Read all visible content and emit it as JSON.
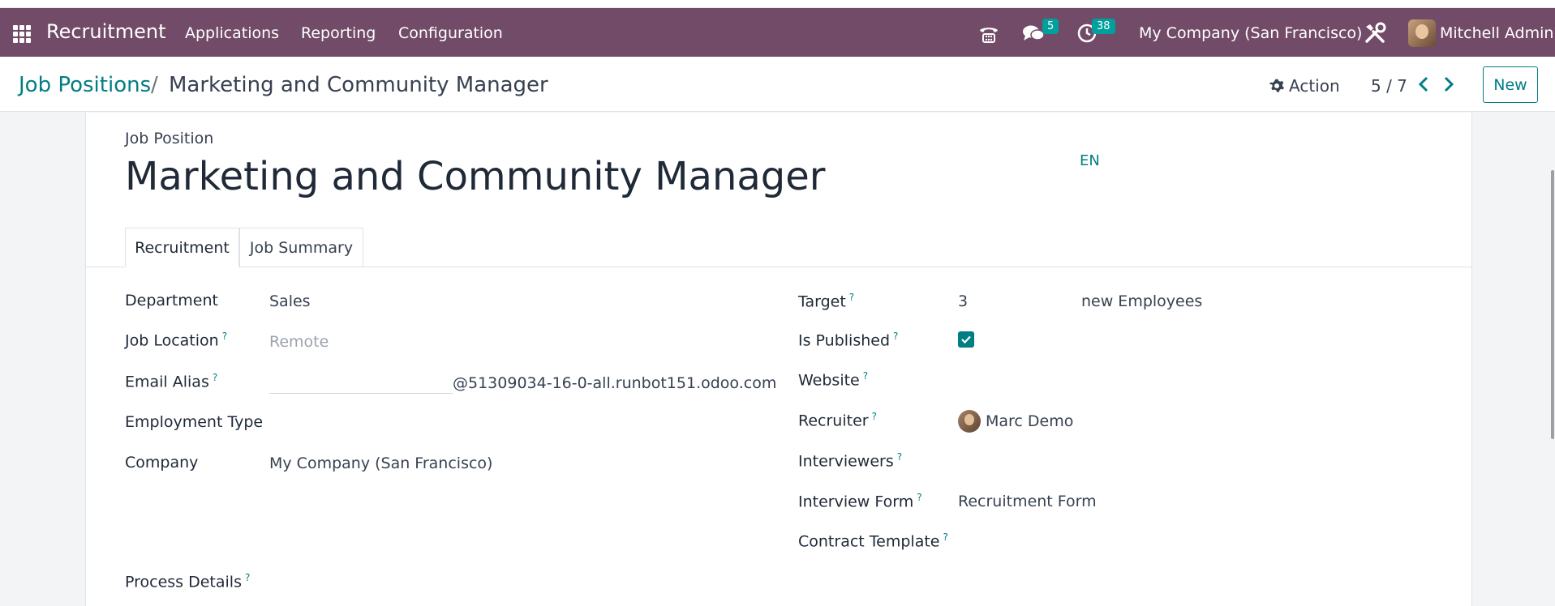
{
  "navbar": {
    "app_name": "Recruitment",
    "menus": [
      "Applications",
      "Reporting",
      "Configuration"
    ],
    "messages_count": "5",
    "activities_count": "38",
    "company": "My Company (San Francisco)",
    "user": "Mitchell Admin",
    "bg_color": "#714b67",
    "badge_color": "#00a09d"
  },
  "control_panel": {
    "breadcrumb_parent": "Job Positions",
    "breadcrumb_sep": "/",
    "breadcrumb_current": "Marketing and Community Manager",
    "action_label": "Action",
    "pager": "5 / 7",
    "new_label": "New"
  },
  "form": {
    "name_label": "Job Position",
    "name": "Marketing and Community Manager",
    "lang": "EN",
    "tabs": [
      "Recruitment",
      "Job Summary"
    ],
    "left": {
      "department_label": "Department",
      "department": "Sales",
      "job_location_label": "Job Location",
      "job_location_placeholder": "Remote",
      "email_alias_label": "Email Alias",
      "email_alias_domain": "@51309034-16-0-all.runbot151.odoo.com",
      "employment_type_label": "Employment Type",
      "company_label": "Company",
      "company": "My Company (San Francisco)",
      "process_details_label": "Process Details"
    },
    "right": {
      "target_label": "Target",
      "target": "3",
      "target_suffix": "new Employees",
      "is_published_label": "Is Published",
      "is_published": true,
      "website_label": "Website",
      "recruiter_label": "Recruiter",
      "recruiter": "Marc Demo",
      "interviewers_label": "Interviewers",
      "interview_form_label": "Interview Form",
      "interview_form": "Recruitment Form",
      "contract_template_label": "Contract Template"
    },
    "help_marker": "?",
    "accent_color": "#017e84"
  }
}
